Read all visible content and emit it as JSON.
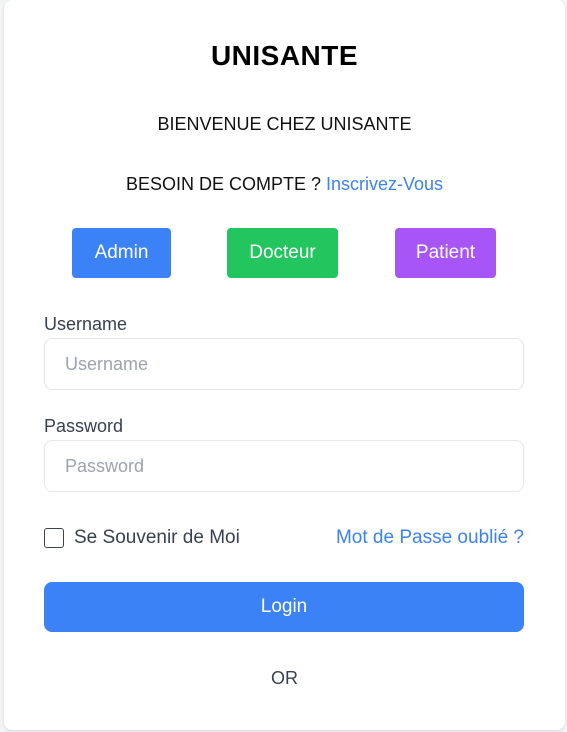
{
  "app": {
    "title": "UNISANTE",
    "welcome": "BIENVENUE CHEZ UNISANTE",
    "need_account_text": "BESOIN DE COMPTE ?",
    "signup_link": "Inscrivez-Vous"
  },
  "roles": [
    {
      "label": "Admin",
      "color": "#3b82f6"
    },
    {
      "label": "Docteur",
      "color": "#22c55e"
    },
    {
      "label": "Patient",
      "color": "#a855f7"
    }
  ],
  "form": {
    "username": {
      "label": "Username",
      "value": "",
      "placeholder": "Username"
    },
    "password": {
      "label": "Password",
      "value": "",
      "placeholder": "Password"
    },
    "remember_label": "Se Souvenir de Moi",
    "remember_checked": false,
    "forgot_link": "Mot de Passe oublié ?",
    "login_label": "Login",
    "or_text": "OR"
  },
  "colors": {
    "primary": "#3b82f6",
    "link": "#3b82f6"
  }
}
